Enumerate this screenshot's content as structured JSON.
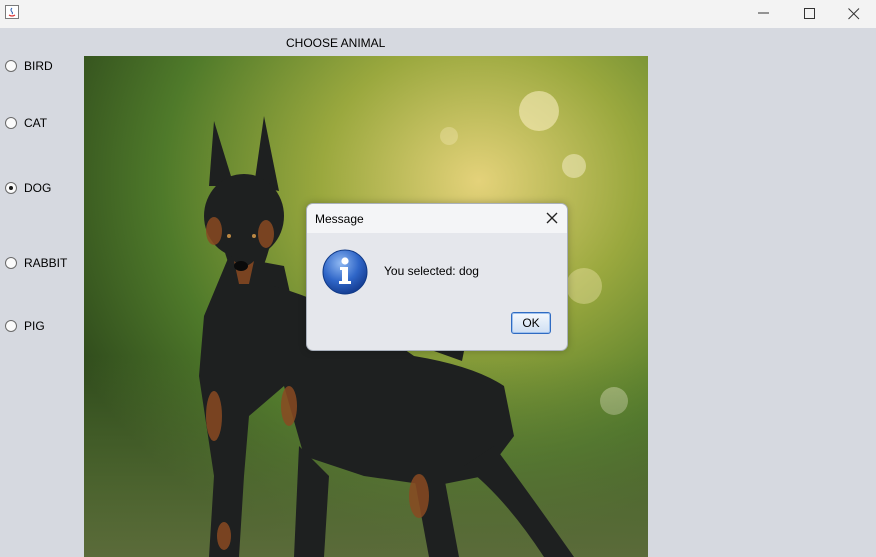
{
  "window": {
    "title": "",
    "controls": [
      "minimize-icon",
      "maximize-icon",
      "close-icon"
    ]
  },
  "main": {
    "heading": "CHOOSE ANIMAL",
    "options": [
      {
        "label": "BIRD",
        "selected": false
      },
      {
        "label": "CAT",
        "selected": false
      },
      {
        "label": "DOG",
        "selected": true
      },
      {
        "label": "RABBIT",
        "selected": false
      },
      {
        "label": "PIG",
        "selected": false
      }
    ],
    "image": {
      "subject": "dog"
    }
  },
  "dialog": {
    "title": "Message",
    "icon": "info-icon",
    "message": "You selected: dog",
    "ok_label": "OK"
  }
}
